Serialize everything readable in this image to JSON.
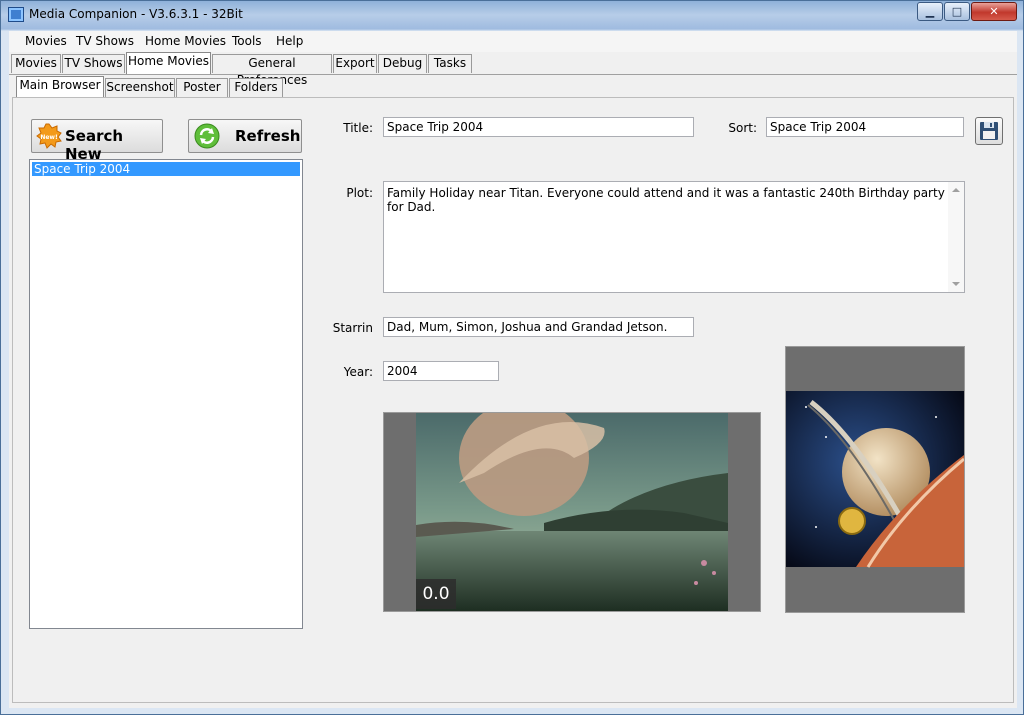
{
  "window": {
    "title": "Media Companion - V3.6.3.1 - 32Bit",
    "min_glyph": "▁",
    "max_glyph": "□",
    "close_glyph": "✕"
  },
  "menubar": [
    "Movies",
    "TV Shows",
    "Home Movies",
    "Tools",
    "Help"
  ],
  "main_tabs": [
    "Movies",
    "TV Shows",
    "Home Movies",
    "General Preferences",
    "Export",
    "Debug",
    "Tasks"
  ],
  "sub_tabs": [
    "Main Browser",
    "Screenshot",
    "Poster",
    "Folders"
  ],
  "buttons": {
    "search_new": "Search New",
    "search_badge": "New!",
    "refresh": "Refresh"
  },
  "list": {
    "items": [
      "Space Trip 2004"
    ]
  },
  "form": {
    "title_label": "Title:",
    "title_value": "Space Trip 2004",
    "sort_label": "Sort:",
    "sort_value": "Space Trip 2004",
    "plot_label": "Plot:",
    "plot_value": "Family Holiday near Titan.  Everyone could attend and it was a fantastic 240th Birthday party for Dad.",
    "starrin_label": "Starrin",
    "starrin_value": "Dad, Mum, Simon, Joshua and Grandad Jetson.",
    "year_label": "Year:",
    "year_value": "2004"
  },
  "screenshot": {
    "rating": "0.0"
  },
  "icons": {
    "save": "floppy-disk-icon",
    "search_new": "new-badge-icon",
    "refresh": "refresh-icon"
  }
}
